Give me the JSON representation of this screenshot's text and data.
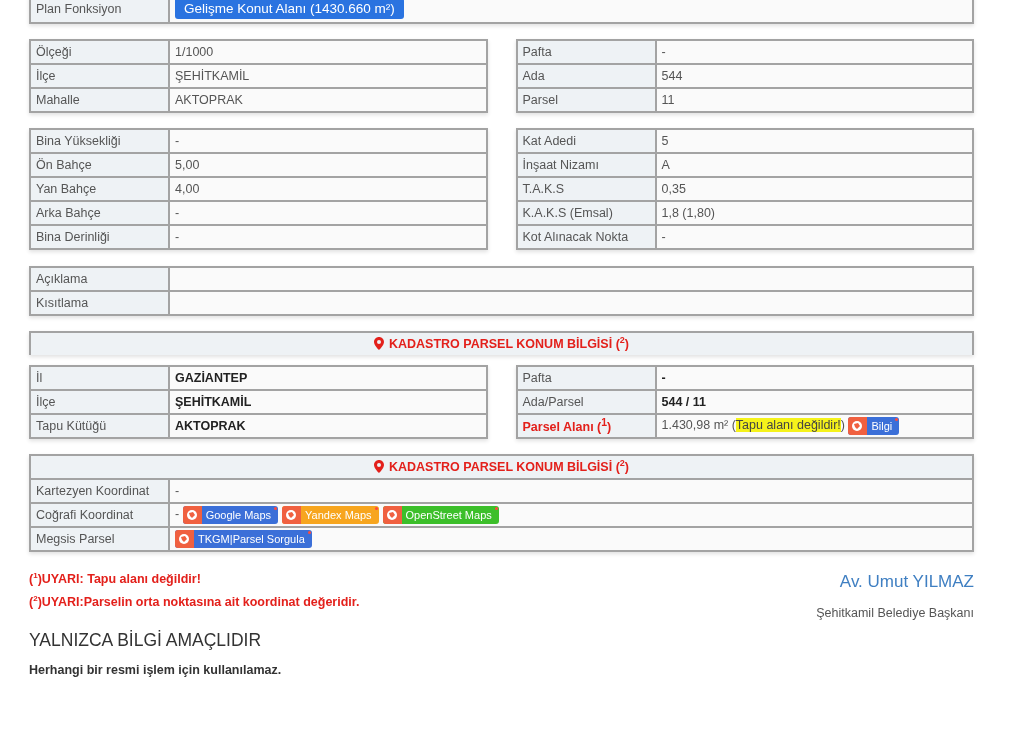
{
  "plan": {
    "label": "Plan Fonksiyon",
    "button": "Gelişme Konut Alanı (1430.660 m²)"
  },
  "pair_sections": [
    {
      "left": [
        {
          "label": "Ölçeği",
          "value": "1/1000",
          "kind": "plain"
        },
        {
          "label": "İlçe",
          "value": "ŞEHİTKAMİL",
          "kind": "plain"
        },
        {
          "label": "Mahalle",
          "value": "AKTOPRAK",
          "kind": "plain"
        }
      ],
      "right": [
        {
          "label": "Pafta",
          "value": "-",
          "kind": "plain"
        },
        {
          "label": "Ada",
          "value": "544",
          "kind": "plain"
        },
        {
          "label": "Parsel",
          "value": "11",
          "kind": "plain"
        }
      ]
    },
    {
      "left": [
        {
          "label": "Bina Yüksekliği",
          "value": "-",
          "kind": "plain"
        },
        {
          "label": "Ön Bahçe",
          "value": "5,00",
          "kind": "plain"
        },
        {
          "label": "Yan Bahçe",
          "value": "4,00",
          "kind": "plain"
        },
        {
          "label": "Arka Bahçe",
          "value": "-",
          "kind": "plain"
        },
        {
          "label": "Bina Derinliği",
          "value": "-",
          "kind": "plain"
        }
      ],
      "right": [
        {
          "label": "Kat Adedi",
          "value": "5",
          "kind": "plain"
        },
        {
          "label": "İnşaat Nizamı",
          "value": "A",
          "kind": "plain"
        },
        {
          "label": "T.A.K.S",
          "value": "0,35",
          "kind": "plain"
        },
        {
          "label": "K.A.K.S (Emsal)",
          "value": "1,8 (1,80)",
          "kind": "plain"
        },
        {
          "label": "Kot Alınacak Nokta",
          "value": "-",
          "kind": "plain"
        }
      ]
    }
  ],
  "notes": [
    {
      "label": "Açıklama"
    },
    {
      "label": "Kısıtlama"
    }
  ],
  "kadastro_header": "KADASTRO PARSEL KONUM BİLGİSİ ($^{2}$)",
  "kadastro": {
    "left": [
      {
        "label": "İl",
        "value": "GAZİANTEP",
        "kind": "bold"
      },
      {
        "label": "İlçe",
        "value": "ŞEHİTKAMİL",
        "kind": "bold"
      },
      {
        "label": "Tapu Kütüğü",
        "value": "AKTOPRAK",
        "kind": "bold"
      }
    ],
    "right": [
      {
        "label": "Pafta",
        "value": "-",
        "kind": "bold"
      },
      {
        "label": "Ada/Parsel",
        "value": "544 / 11",
        "kind": "bold"
      },
      {
        "label": "Parsel Alanı ($^{1}$)",
        "value": "1.430,98 m² (",
        "highlight": "Tapu alanı değildir!",
        "after": ")",
        "kind": "area",
        "links": [
          {
            "label": "Bilgi",
            "color": "#3b6fd8"
          }
        ]
      }
    ]
  },
  "coordinates": {
    "header": "KADASTRO PARSEL KONUM BİLGİSİ ($^{2}$)",
    "rows": [
      {
        "label": "Kartezyen Koordinat",
        "value": "-",
        "kind": "plain"
      },
      {
        "label": "Coğrafi Koordinat",
        "value": "-",
        "kind": "links",
        "links": [
          {
            "label": "Google Maps",
            "color": "#3b6fd8"
          },
          {
            "label": "Yandex Maps",
            "color": "#f7a51e"
          },
          {
            "label": "OpenStreet Maps",
            "color": "#3cbf2a"
          }
        ]
      },
      {
        "label": "Megsis Parsel",
        "kind": "links",
        "links": [
          {
            "label": "TKGM|Parsel Sorgula",
            "color": "#3b6fd8"
          }
        ]
      }
    ]
  },
  "warnings": [
    "($^{1}$)UYARI: Tapu alanı değildir!",
    "($^{2}$)UYARI:Parselin orta noktasına ait koordinat değeridir."
  ],
  "signature": {
    "name": "Av. Umut YILMAZ",
    "title": "Şehitkamil Belediye Başkanı"
  },
  "disclaimer": {
    "title": "YALNIZCA BİLGİ AMAÇLIDIR",
    "text": "Herhangi bir resmi işlem için kullanılamaz."
  }
}
